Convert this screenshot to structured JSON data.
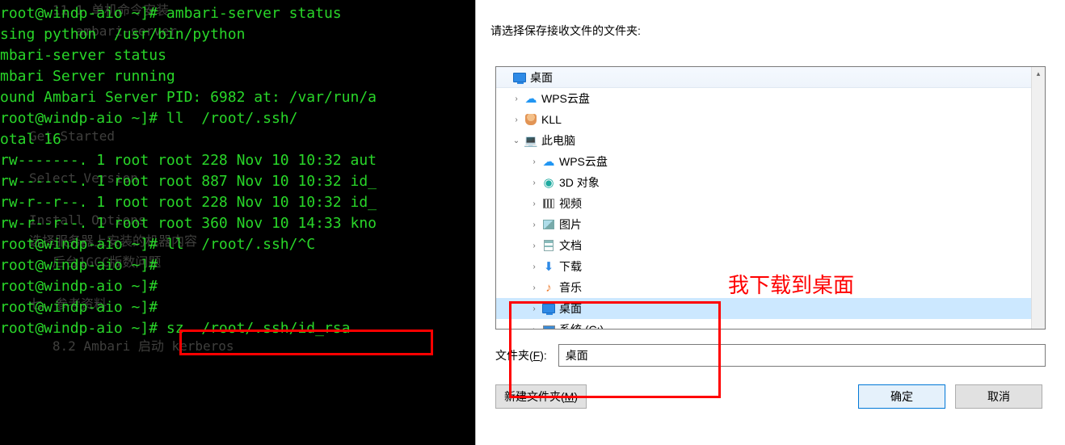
{
  "terminal": {
    "bg_lines": [
      "   11.1 单机命令安装",
      "      ambari-server",
      "",
      "",
      "",
      "",
      "Get Started",
      "",
      "Select Version",
      "",
      "Install Options",
      "选择服务器上安装的机器内容",
      "   后台1GCC版数问题",
      "",
      "七、参考资料",
      "",
      "   8.2 Ambari 启动 kerberos"
    ],
    "fg_lines": [
      "root@windp-aio ~]# ambari-server status",
      "sing python  /usr/bin/python",
      "mbari-server status",
      "mbari Server running",
      "ound Ambari Server PID: 6982 at: /var/run/a",
      "root@windp-aio ~]# ll  /root/.ssh/",
      "otal 16",
      "rw-------. 1 root root 228 Nov 10 10:32 aut",
      "rw-------. 1 root root 887 Nov 10 10:32 id_",
      "rw-r--r--. 1 root root 228 Nov 10 10:32 id_",
      "rw-r--r--. 1 root root 360 Nov 10 14:33 kno",
      "root@windp-aio ~]# ll  /root/.ssh/^C",
      "root@windp-aio ~]#",
      "root@windp-aio ~]#",
      "root@windp-aio ~]#",
      "root@windp-aio ~]# sz  /root/.ssh/id_rsa"
    ],
    "highlighted_command": "sz  /root/.ssh/id_rsa"
  },
  "dialog": {
    "prompt": "请选择保存接收文件的文件夹:",
    "tree": {
      "root": {
        "label": "桌面",
        "icon": "desktop"
      },
      "items": [
        {
          "level": 1,
          "expander": ">",
          "icon": "cloud",
          "label": "WPS云盘"
        },
        {
          "level": 1,
          "expander": ">",
          "icon": "person",
          "label": "KLL"
        },
        {
          "level": 1,
          "expander": "v",
          "icon": "pc",
          "label": "此电脑"
        },
        {
          "level": 2,
          "expander": ">",
          "icon": "cloud",
          "label": "WPS云盘"
        },
        {
          "level": 2,
          "expander": ">",
          "icon": "3d",
          "label": "3D 对象"
        },
        {
          "level": 2,
          "expander": ">",
          "icon": "video",
          "label": "视频"
        },
        {
          "level": 2,
          "expander": ">",
          "icon": "pic",
          "label": "图片"
        },
        {
          "level": 2,
          "expander": ">",
          "icon": "doc",
          "label": "文档"
        },
        {
          "level": 2,
          "expander": ">",
          "icon": "down",
          "label": "下载"
        },
        {
          "level": 2,
          "expander": ">",
          "icon": "music",
          "label": "音乐"
        },
        {
          "level": 2,
          "expander": ">",
          "icon": "desktop",
          "label": "桌面",
          "selected": true
        },
        {
          "level": 2,
          "expander": ">",
          "icon": "drive",
          "label": "系统 (C:)"
        }
      ]
    },
    "folder_label_prefix": "文件夹(",
    "folder_label_key": "F",
    "folder_label_suffix": "):",
    "folder_value": "桌面",
    "new_folder_btn_prefix": "新建文件夹(",
    "new_folder_btn_key": "M",
    "new_folder_btn_suffix": ")",
    "ok_btn": "确定",
    "cancel_btn": "取消"
  },
  "annotation": {
    "text": "我下载到桌面",
    "color": "#ff0000"
  }
}
